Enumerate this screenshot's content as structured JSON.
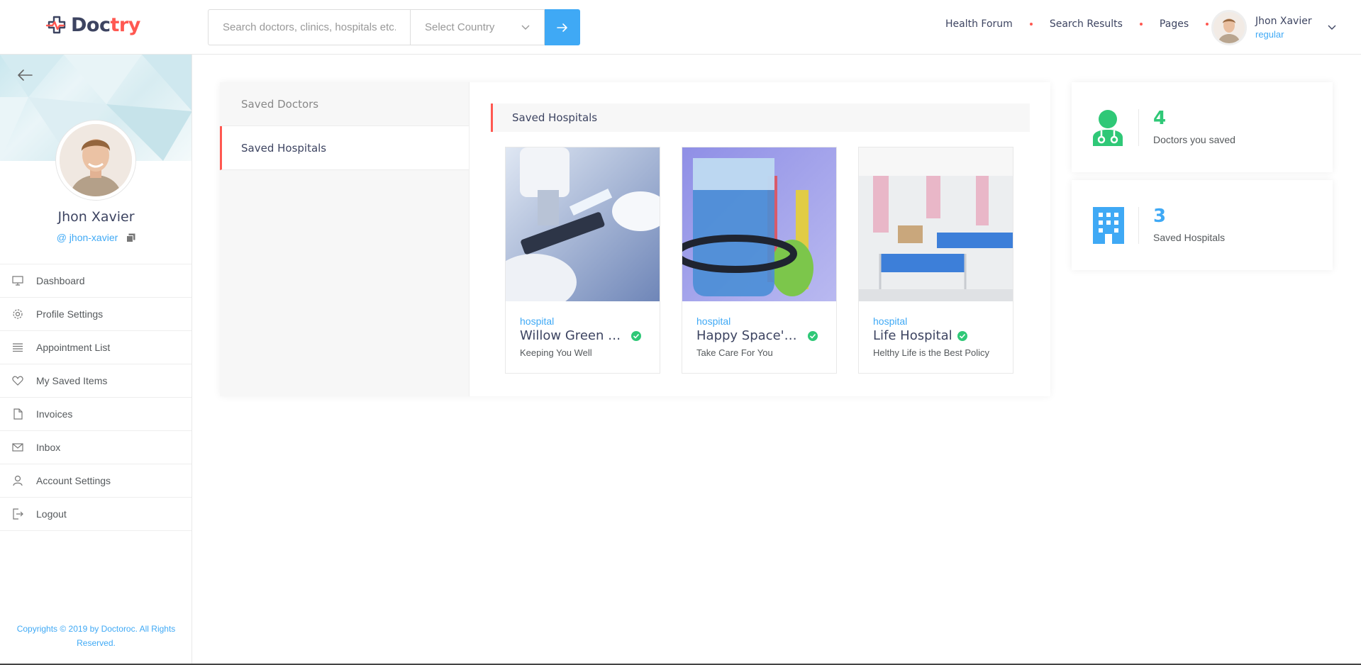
{
  "colors": {
    "accent_blue": "#3fa9f5",
    "accent_red": "#ff5851",
    "accent_green": "#2fc877",
    "text_dark": "#3d4461"
  },
  "header": {
    "logo_doc": "Doc",
    "logo_try": "try",
    "search_placeholder": "Search doctors, clinics, hospitals etc.",
    "country_select": "Select Country",
    "nav": [
      "Health Forum",
      "Search Results",
      "Pages"
    ],
    "user": {
      "name": "Jhon Xavier",
      "role": "regular"
    }
  },
  "sidebar": {
    "profile_name": "Jhon Xavier",
    "profile_handle": "@ jhon-xavier",
    "items": [
      {
        "label": "Dashboard",
        "icon": "monitor-icon"
      },
      {
        "label": "Profile Settings",
        "icon": "gear-icon"
      },
      {
        "label": "Appointment List",
        "icon": "list-icon"
      },
      {
        "label": "My Saved Items",
        "icon": "heart-icon"
      },
      {
        "label": "Invoices",
        "icon": "file-icon"
      },
      {
        "label": "Inbox",
        "icon": "envelope-icon"
      },
      {
        "label": "Account Settings",
        "icon": "user-icon"
      },
      {
        "label": "Logout",
        "icon": "logout-icon"
      }
    ],
    "copyright": "Copyrights © 2019 by Doctoroc. All Rights Reserved."
  },
  "main": {
    "tabs": [
      {
        "label": "Saved Doctors",
        "active": false
      },
      {
        "label": "Saved Hospitals",
        "active": true
      }
    ],
    "section_title": "Saved Hospitals",
    "hospitals": [
      {
        "tag": "hospital",
        "name": "Willow Green H...",
        "tagline": "Keeping You Well"
      },
      {
        "tag": "hospital",
        "name": "Happy Space's ...",
        "tagline": "Take Care For You"
      },
      {
        "tag": "hospital",
        "name": "Life Hospital",
        "tagline": "Helthy Life is the Best Policy"
      }
    ]
  },
  "stats": [
    {
      "value": "4",
      "label": "Doctors you saved",
      "color": "#2fc877",
      "icon": "doctor-icon"
    },
    {
      "value": "3",
      "label": "Saved Hospitals",
      "color": "#3fa9f5",
      "icon": "building-icon"
    }
  ]
}
